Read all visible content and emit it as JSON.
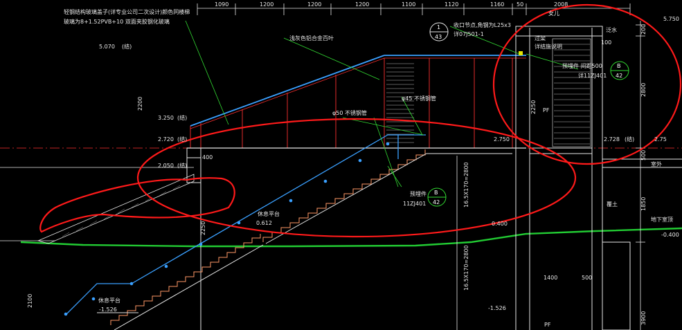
{
  "colors": {
    "background": "#000000",
    "dimension": "#e8e8e8",
    "wall": "#e8e8e8",
    "railing": "#ff3030",
    "handrail": "#3aa0ff",
    "ground_line": "#22cc33",
    "markup_circle": "#ff1a1a",
    "leader_line": "#33dd33",
    "detail_marker": "#33dd33",
    "stair_steps": "#ff9966"
  },
  "top_dimensions": [
    "1090",
    "1200",
    "1200",
    "1200",
    "1100",
    "1120",
    "1160",
    "50",
    "2008"
  ],
  "right_dimensions": [
    "5.750",
    "200",
    "2800",
    "500",
    "1850"
  ],
  "notes": {
    "glass_canopy_1": "轻钢结构玻璃盖子(详专业公司二次设计)颜色同楼梯",
    "glass_canopy_2": "玻璃为8+1.52PVB+10  双面夹胶钢化玻璃",
    "aluminum_louver": "浅灰色铝合金百叶",
    "stainless_45": "φ45 不锈钢管",
    "stainless_50": "φ50 不锈钢管",
    "gutter_1": "收口节点,角钢为L25x3",
    "gutter_2": "详07J501-1",
    "roof_edge_1": "女儿",
    "roof_edge_2": "泛水",
    "overflow_1": "过梁",
    "overflow_2": "详结施说明",
    "embedded_1": "预埋件 间距500",
    "embedded_2": "详11ZJ401",
    "embedded_3": "预埋件",
    "embedded_4": "11ZJ401",
    "landing_1": "休息平台",
    "landing_2": "休息平台",
    "pf_1": "PF",
    "pf_2": "PF",
    "soil": "覆土",
    "stair_count_1": "16.5X170=2800",
    "stair_count_2": "16.5X170=2800",
    "right_label_1": "室外",
    "right_label_2": "地下室顶"
  },
  "elevations": {
    "e5070": "5.070",
    "e3250": "3.250",
    "e2720": "2.720",
    "e2050": "2.050",
    "e2750": "2.750",
    "e2728": "2.728",
    "e2750b": "2.75",
    "e0612": "0.612",
    "e_1526a": "-1.526",
    "e_1526b": "-1.526",
    "e0400": "-0.400",
    "e0430": "0.400",
    "jian": "(结)"
  },
  "dims": {
    "d2200": "2200",
    "d2250": "2250",
    "d2250b": "2250",
    "d400": "400",
    "d2100": "2100",
    "d1400": "1400",
    "d500": "500",
    "d100": "100",
    "d1850": "1850",
    "d3900": "3900",
    "d200": "200"
  },
  "markers": {
    "m1_top": "1",
    "m1_bottom": "43",
    "m2_top": "B",
    "m2_bottom": "42",
    "m3_top": "B",
    "m3_bottom": "42"
  }
}
